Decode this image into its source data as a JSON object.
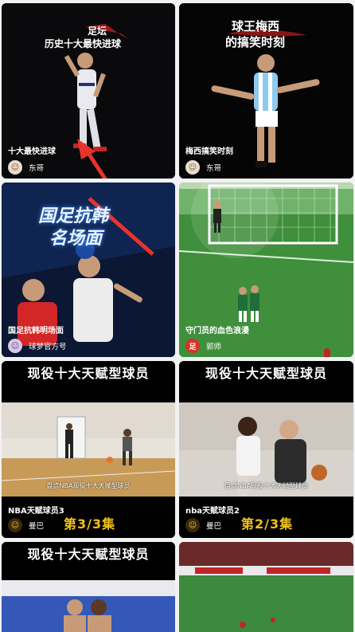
{
  "feed": {
    "cards": [
      {
        "title": "十大最快进球",
        "author": "东哥",
        "overlay_line1": "足坛",
        "overlay_line2": "历史十大最快进球"
      },
      {
        "title": "梅西搞笑时刻",
        "author": "东哥",
        "overlay_line1": "球王梅西",
        "overlay_line2": "的搞笑时刻"
      },
      {
        "title": "国足抗韩明场面",
        "author": "球梦官方号",
        "overlay_line1": "国足抗韩",
        "overlay_line2": "名场面"
      },
      {
        "title": "守门员的血色浪漫",
        "author": "郭师"
      },
      {
        "title": "NBA天赋球员3",
        "author": "曼巴",
        "banner": "现役十大天赋型球员",
        "subcap": "盘点NBA现役十大天赋型球员",
        "episode": "第3/3集"
      },
      {
        "title": "nba天赋球员2",
        "author": "曼巴",
        "banner": "现役十大天赋型球员",
        "subcap": "盘点NBA现役十大天赋型球员",
        "episode": "第2/3集"
      },
      {
        "banner": "现役十大天赋型球员"
      },
      {}
    ]
  },
  "colors": {
    "accent_red": "#e8332c",
    "episode_yellow": "#f2c318",
    "pitch_green": "#3f8f3c"
  }
}
